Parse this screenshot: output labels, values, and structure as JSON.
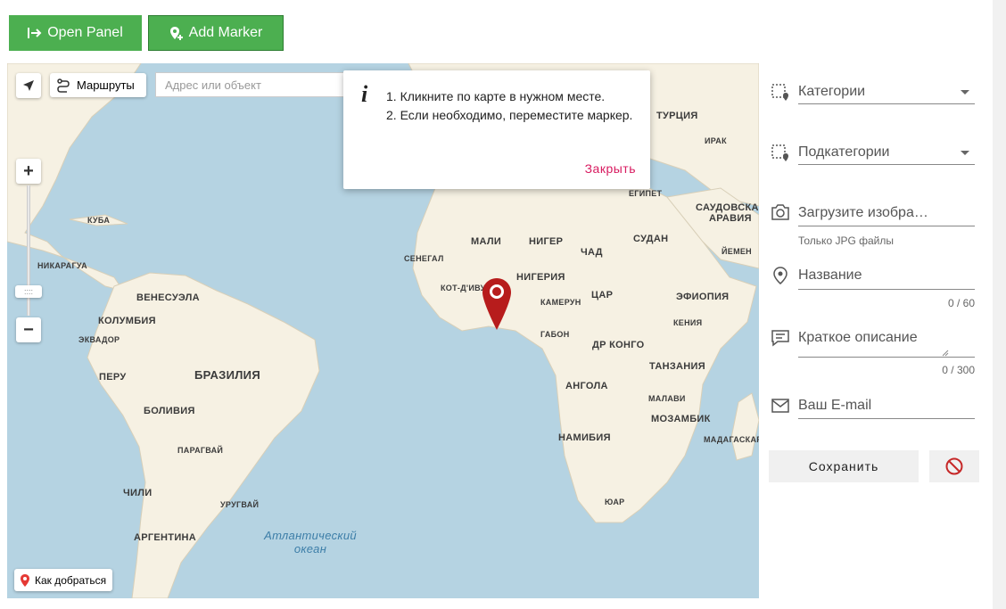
{
  "toolbar": {
    "open_panel_label": "Open Panel",
    "add_marker_label": "Add Marker"
  },
  "map": {
    "routes_label": "Маршруты",
    "search_placeholder": "Адрес или объект",
    "how_to_get_label": "Как добраться",
    "labels": {
      "turkey": "ТУРЦИЯ",
      "iran": "ИРАК",
      "egypt": "ЕГИПЕТ",
      "saudi_1": "САУДОВСКАЯ",
      "saudi_2": "АРАВИЯ",
      "yemen": "ЙЕМЕН",
      "cuba": "КУБА",
      "nicaragua": "НИКАРАГУА",
      "venezuela": "ВЕНЕСУЭЛА",
      "colombia": "КОЛУМБИЯ",
      "ecuador": "ЭКВАДОР",
      "peru": "ПЕРУ",
      "brazil": "БРАЗИЛИЯ",
      "bolivia": "БОЛИВИЯ",
      "paraguay": "ПАРАГВАЙ",
      "chile": "ЧИЛИ",
      "uruguay": "УРУГВАЙ",
      "argentina": "АРГЕНТИНА",
      "mali": "МАЛИ",
      "niger": "НИГЕР",
      "chad": "ЧАД",
      "sudan": "СУДАН",
      "senegal": "СЕНЕГАЛ",
      "nigeria": "НИГЕРИЯ",
      "cote": "КОТ-Д'ИВУАР",
      "car": "ЦАР",
      "ethiopia": "ЭФИОПИЯ",
      "cameroon": "КАМЕРУН",
      "kenya": "КЕНИЯ",
      "gabon": "ГАБОН",
      "drc": "ДР КОНГО",
      "tanzania": "ТАНЗАНИЯ",
      "angola": "АНГОЛА",
      "malawi": "МАЛАВИ",
      "mozambique": "МОЗАМБИК",
      "namibia": "НАМИБИЯ",
      "madagascar": "МАДАГАСКАР",
      "sar": "ЮАР",
      "ocean_1": "Атлантический",
      "ocean_2": "океан"
    }
  },
  "popup": {
    "icon": "i",
    "step1": "1. Кликните по карте в нужном месте.",
    "step2": "2. Если необходимо, переместите маркер.",
    "close_label": "Закрыть"
  },
  "form": {
    "category_placeholder": "Категории",
    "subcategory_placeholder": "Подкатегории",
    "upload_placeholder": "Загрузите изобра…",
    "upload_hint": "Только JPG файлы",
    "name_placeholder": "Название",
    "name_counter": "0 / 60",
    "description_placeholder": "Краткое описание",
    "description_counter": "0 / 300",
    "email_placeholder": "Ваш E-mail",
    "save_label": "Сохранить"
  },
  "colors": {
    "button_green": "#4caf50",
    "marker_red": "#b71c1c",
    "close_pink": "#d81b60",
    "ocean": "#b5d3e2",
    "land": "#f6f1e3"
  }
}
